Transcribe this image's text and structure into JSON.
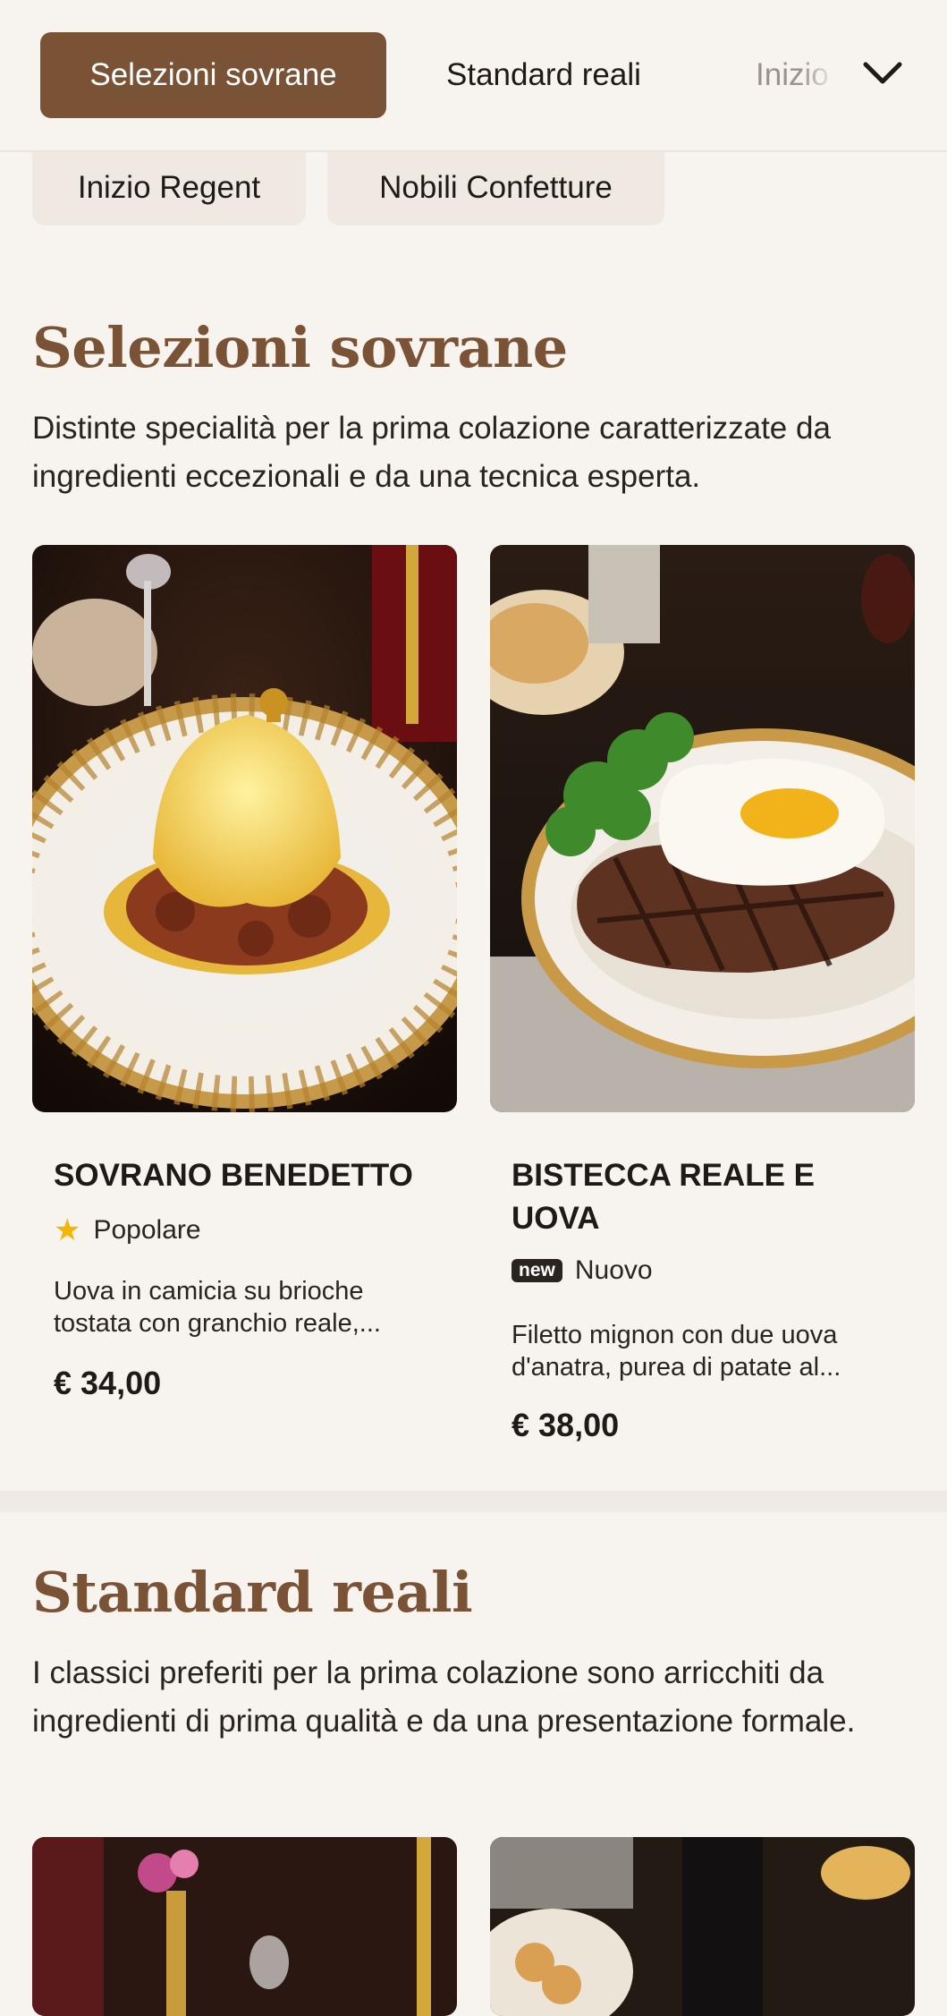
{
  "nav": {
    "active_tab": "Selezioni sovrane",
    "tabs": [
      "Standard reali",
      "Inizio"
    ],
    "chips": [
      "Inizio Regent",
      "Nobili Confetture"
    ]
  },
  "sections": [
    {
      "title": "Selezioni sovrane",
      "description": "Distinte specialità per la prima colazione caratterizzate da ingredienti eccezionali e da una tecnica esperta.",
      "items": [
        {
          "name": "SOVRANO BENEDETTO",
          "tag": "Popolare",
          "tag_icon": "star-icon",
          "description": "Uova in camicia su brioche tostata con granchio reale,...",
          "price": "€ 34,00"
        },
        {
          "name": "BISTECCA REALE E UOVA",
          "tag": "Nuovo",
          "tag_badge": "new",
          "description": "Filetto mignon con due uova d'anatra, purea di patate al...",
          "price": "€ 38,00"
        }
      ]
    },
    {
      "title": "Standard reali",
      "description": "I classici preferiti per la prima colazione sono arricchiti da ingredienti di prima qualità e da una presentazione formale."
    }
  ],
  "colors": {
    "accent": "#7a5236",
    "background": "#f7f3ee",
    "star": "#f2b705"
  }
}
